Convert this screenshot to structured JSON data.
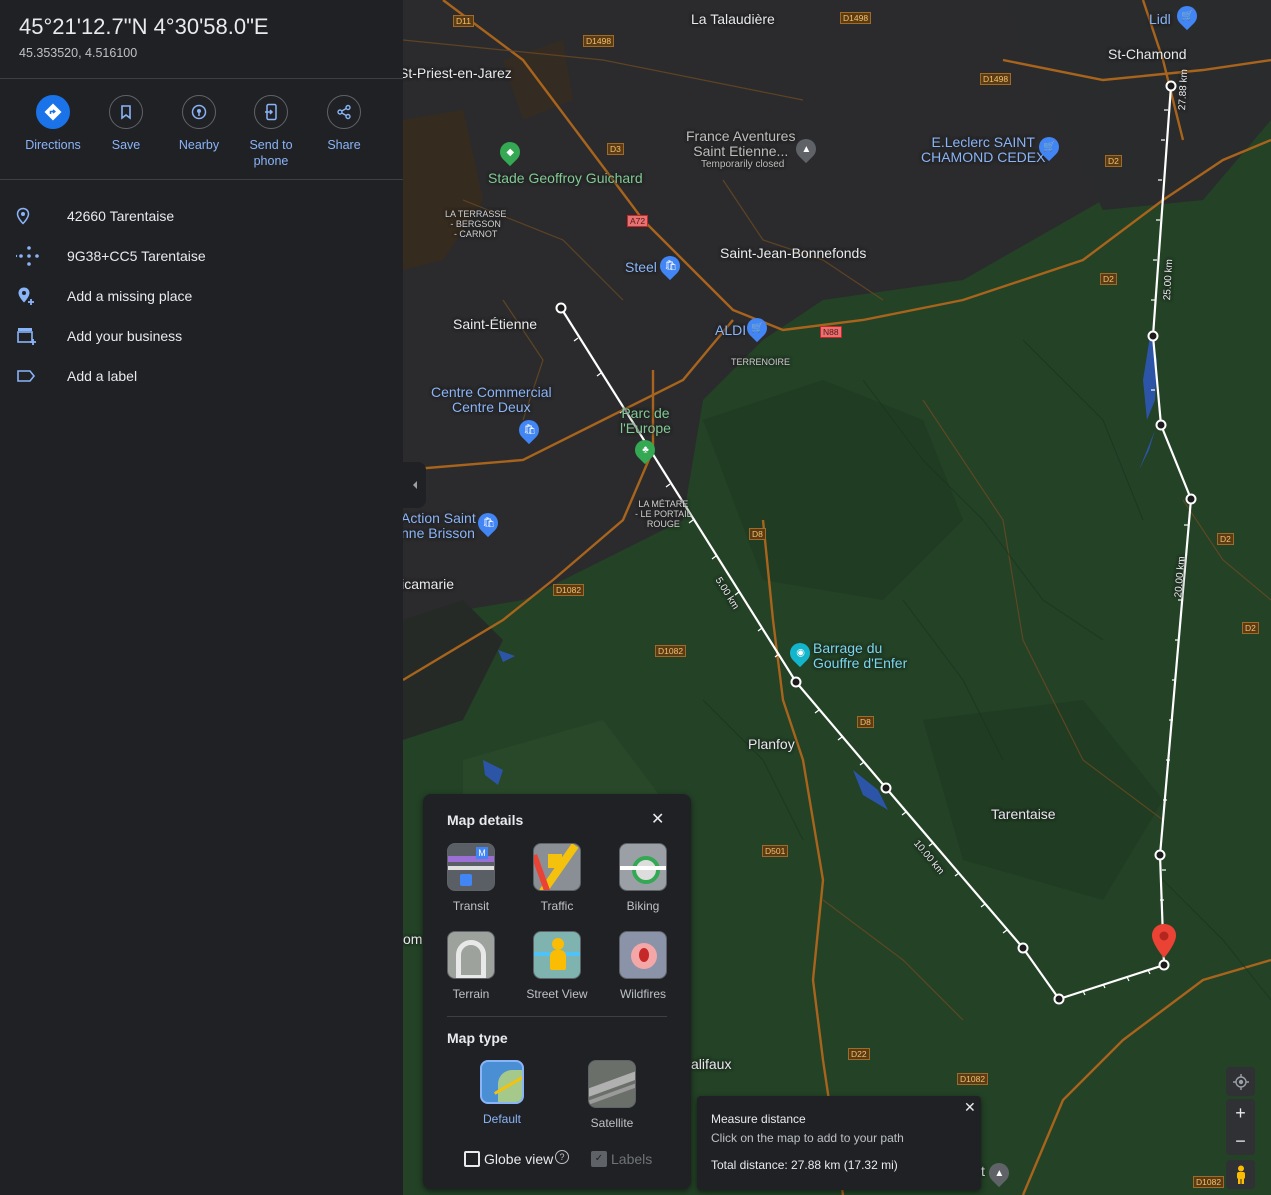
{
  "place": {
    "title": "45°21'12.7\"N 4°30'58.0\"E",
    "decimal": "45.353520, 4.516100"
  },
  "actions": [
    {
      "label": "Directions",
      "icon": "directions-icon"
    },
    {
      "label": "Save",
      "icon": "bookmark-icon"
    },
    {
      "label": "Nearby",
      "icon": "nearby-icon"
    },
    {
      "label": "Send to phone",
      "icon": "send-to-phone-icon"
    },
    {
      "label": "Share",
      "icon": "share-icon"
    }
  ],
  "info": [
    {
      "text": "42660 Tarentaise",
      "icon": "location-pin-icon"
    },
    {
      "text": "9G38+CC5 Tarentaise",
      "icon": "plus-code-icon"
    },
    {
      "text": "Add a missing place",
      "icon": "add-location-icon"
    },
    {
      "text": "Add your business",
      "icon": "add-business-icon"
    },
    {
      "text": "Add a label",
      "icon": "label-icon"
    }
  ],
  "map_labels": {
    "st_priest": "St-Priest-en-Jarez",
    "talaudiere": "La Talaudière",
    "st_chamond": "St-Chamond",
    "lidl": "Lidl",
    "france_aventures": "France Aventures\nSaint Etienne...",
    "temp_closed": "Temporarily closed",
    "leclerc": "E.Leclerc SAINT\nCHAMOND CEDEX",
    "stade": "Stade Geoffroy Guichard",
    "terrasse": "LA TERRASSE\n- BERGSON\n- CARNOT",
    "st_jean": "Saint-Jean-Bonnefonds",
    "steel": "Steel",
    "st_etienne": "Saint-Étienne",
    "aldi": "ALDI",
    "terrenoire": "TERRENOIRE",
    "centre_commercial": "Centre Commercial\nCentre Deux",
    "parc_europe": "Parc de\nl'Europe",
    "metare": "LA MÉTARE\n- LE PORTAIL\nROUGE",
    "action": "Action Saint\nnne Brisson",
    "ricamarie": "Ricamarie",
    "barrage": "Barrage du\nGouffre d'Enfer",
    "planfoy": "Planfoy",
    "tarentaise": "Tarentaise",
    "com": "om",
    "salifaux": "alifaux",
    "bottom_t": "t"
  },
  "roads": [
    "D11",
    "D1498",
    "D1498",
    "D1498",
    "D3",
    "A72",
    "D2",
    "D2",
    "N88",
    "D8",
    "D1082",
    "D1082",
    "D8",
    "D2",
    "D2",
    "D501",
    "D22",
    "D1082",
    "D1082"
  ],
  "measure_path": {
    "distance_labels": [
      "5.00 km",
      "10.00 km",
      "20.00 km",
      "25.00 km",
      "27.88 km"
    ]
  },
  "map_details": {
    "title": "Map details",
    "layers": [
      {
        "label": "Transit",
        "icon": "transit-icon"
      },
      {
        "label": "Traffic",
        "icon": "traffic-icon"
      },
      {
        "label": "Biking",
        "icon": "biking-icon"
      },
      {
        "label": "Terrain",
        "icon": "terrain-icon"
      },
      {
        "label": "Street View",
        "icon": "street-view-icon"
      },
      {
        "label": "Wildfires",
        "icon": "wildfires-icon"
      }
    ],
    "map_type_title": "Map type",
    "types": [
      {
        "label": "Default",
        "selected": true
      },
      {
        "label": "Satellite",
        "selected": false
      }
    ],
    "globe_view": "Globe view",
    "labels": "Labels"
  },
  "measure": {
    "title": "Measure distance",
    "hint": "Click on the map to add to your path",
    "total": "Total distance: 27.88 km (17.32 mi)"
  },
  "colors": {
    "accent": "#8ab4f8",
    "primary_blue": "#1a73e8",
    "panel_bg": "#202124",
    "map_green": "#234226",
    "urban_gray": "#2a2a2c",
    "road_orange": "#a8641c",
    "pin_red": "#ea4335"
  }
}
